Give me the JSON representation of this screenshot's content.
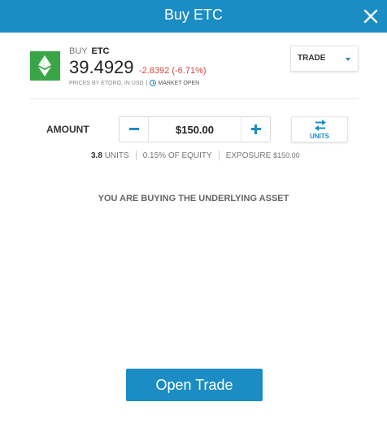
{
  "colors": {
    "accent": "#1b8cc4",
    "asset_logo": "#3aa547",
    "negative": "#d6453d"
  },
  "header": {
    "title": "Buy ETC",
    "close_icon": "close-icon"
  },
  "asset": {
    "logo_icon": "ethereum-classic-icon",
    "action": "BUY",
    "symbol": "ETC",
    "price": "39.4929",
    "change": "-2.8392 (-6.71%)",
    "prices_by": "PRICES BY ETORO, IN USD",
    "separator": "|",
    "market_status": "MARKET OPEN",
    "status_icon": "clock-icon"
  },
  "trade_dropdown": {
    "label": "TRADE",
    "icon": "chevron-down-icon"
  },
  "amount": {
    "label": "AMOUNT",
    "value": "$150.00",
    "decrease_icon": "minus-icon",
    "increase_icon": "plus-icon"
  },
  "units_toggle": {
    "label": "UNITS",
    "icon": "swap-icon"
  },
  "stats": {
    "units_value": "3.8",
    "units_label": "UNITS",
    "equity": "0.15% OF EQUITY",
    "exposure_label": "EXPOSURE",
    "exposure_value": "$150.00"
  },
  "notice": "YOU ARE BUYING THE UNDERLYING ASSET",
  "open_trade_label": "Open Trade"
}
